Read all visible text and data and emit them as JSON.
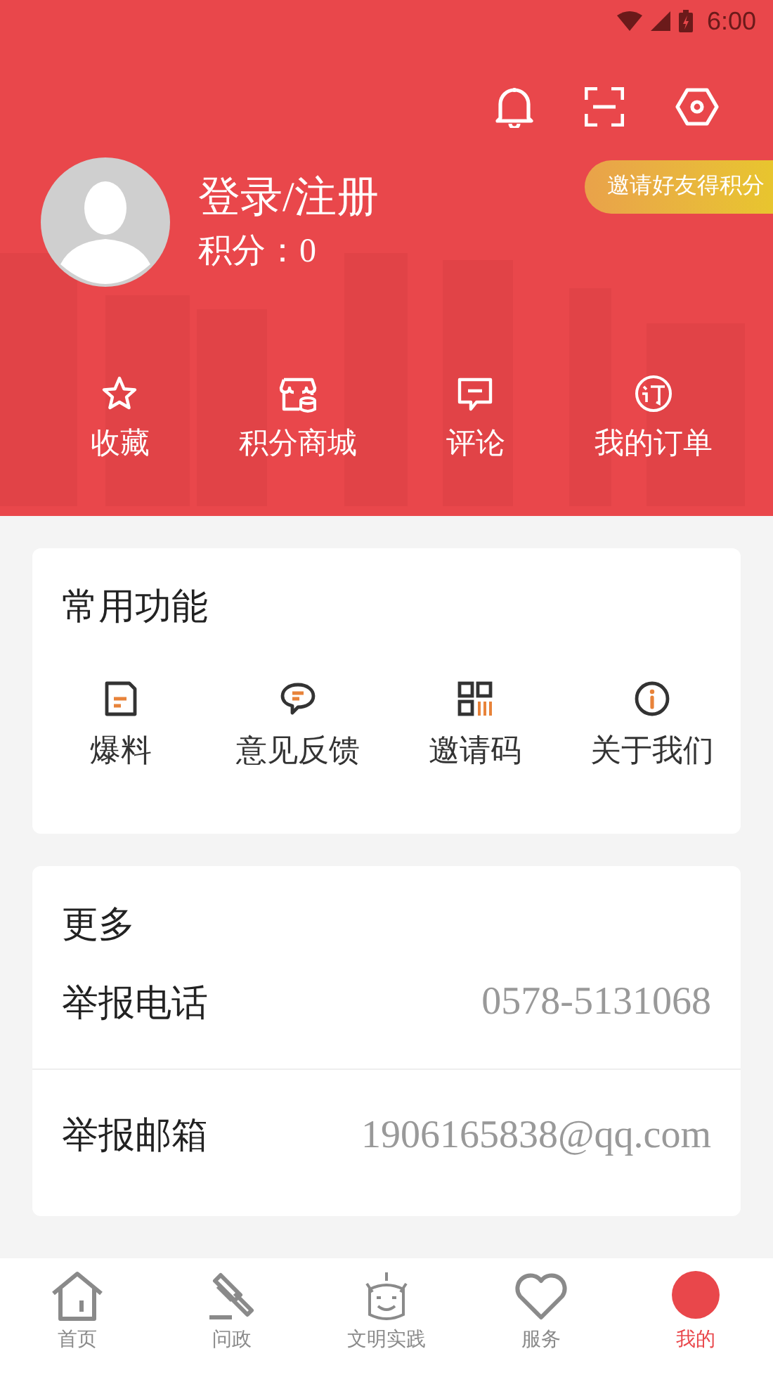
{
  "status_bar": {
    "time": "6:00"
  },
  "profile": {
    "name": "登录/注册",
    "points": "积分：0",
    "invite_button": "邀请好友得积分"
  },
  "shortcuts": [
    {
      "label": "收藏"
    },
    {
      "label": "积分商城"
    },
    {
      "label": "评论"
    },
    {
      "label": "我的订单"
    }
  ],
  "common_functions": {
    "title": "常用功能",
    "items": [
      {
        "label": "爆料"
      },
      {
        "label": "意见反馈"
      },
      {
        "label": "邀请码"
      },
      {
        "label": "关于我们"
      }
    ]
  },
  "more": {
    "title": "更多",
    "rows": [
      {
        "label": "举报电话",
        "value": "0578-5131068"
      },
      {
        "label": "举报邮箱",
        "value": "1906165838@qq.com"
      }
    ]
  },
  "tab_bar": [
    {
      "label": "首页",
      "selected": false
    },
    {
      "label": "问政",
      "selected": false
    },
    {
      "label": "文明实践",
      "selected": false
    },
    {
      "label": "服务",
      "selected": false
    },
    {
      "label": "我的",
      "selected": true
    }
  ]
}
